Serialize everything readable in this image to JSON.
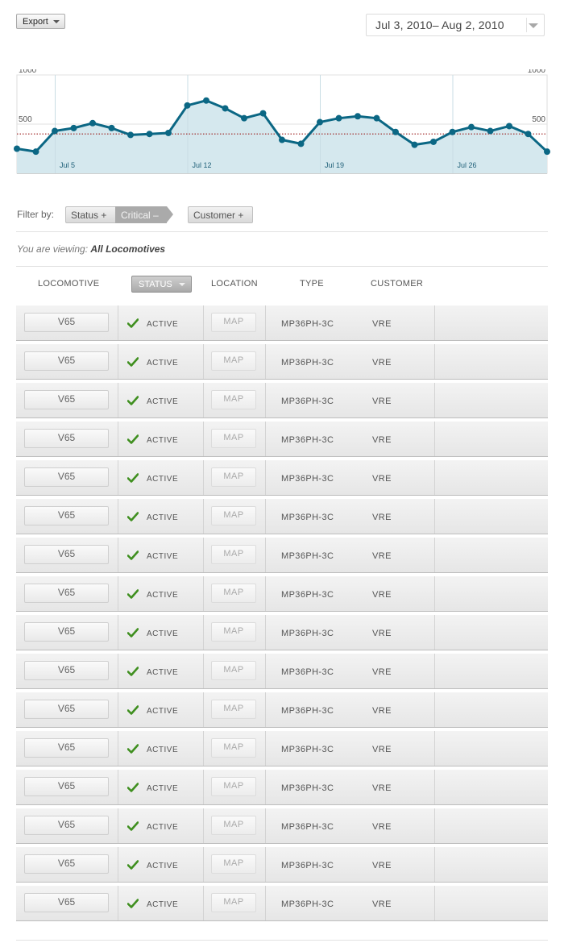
{
  "toolbar": {
    "export_label": "Export",
    "date_range": "Jul 3, 2010– Aug 2, 2010"
  },
  "chart_data": {
    "type": "area",
    "x_days": [
      3,
      4,
      5,
      6,
      7,
      8,
      9,
      10,
      11,
      12,
      13,
      14,
      15,
      16,
      17,
      18,
      19,
      20,
      21,
      22,
      23,
      24,
      25,
      26,
      27,
      28,
      29,
      30
    ],
    "x_tick_labels": [
      "Jul 5",
      "Jul 12",
      "Jul 19",
      "Jul 26"
    ],
    "x_tick_days": [
      5,
      12,
      19,
      26
    ],
    "values": [
      250,
      220,
      430,
      460,
      510,
      460,
      390,
      400,
      410,
      690,
      740,
      660,
      560,
      610,
      340,
      300,
      520,
      560,
      580,
      560,
      420,
      290,
      320,
      420,
      470,
      430,
      480,
      400,
      220
    ],
    "y_ticks": [
      500,
      1000
    ],
    "y_tick_labels_left": [
      "500",
      "1000"
    ],
    "y_tick_labels_right": [
      "500",
      "1000"
    ],
    "ylim": [
      0,
      1000
    ],
    "threshold": 400,
    "line_color": "#0b6784",
    "fill_color": "#d5e8ee",
    "threshold_color": "#9b1c1c",
    "grid": true
  },
  "filters": {
    "label": "Filter by:",
    "status": "Status +",
    "critical": "Critical –",
    "customer": "Customer +"
  },
  "viewing": {
    "prefix": "You are viewing:",
    "value": "All Locomotives"
  },
  "columns": {
    "locomotive": "Locomotive",
    "status": "Status",
    "location": "Location",
    "type": "Type",
    "customer": "Customer"
  },
  "rows": [
    {
      "loco": "V65",
      "status": "ACTIVE",
      "map": "MAP",
      "type": "MP36PH-3C",
      "customer": "VRE"
    },
    {
      "loco": "V65",
      "status": "ACTIVE",
      "map": "MAP",
      "type": "MP36PH-3C",
      "customer": "VRE"
    },
    {
      "loco": "V65",
      "status": "ACTIVE",
      "map": "MAP",
      "type": "MP36PH-3C",
      "customer": "VRE"
    },
    {
      "loco": "V65",
      "status": "ACTIVE",
      "map": "MAP",
      "type": "MP36PH-3C",
      "customer": "VRE"
    },
    {
      "loco": "V65",
      "status": "ACTIVE",
      "map": "MAP",
      "type": "MP36PH-3C",
      "customer": "VRE"
    },
    {
      "loco": "V65",
      "status": "ACTIVE",
      "map": "MAP",
      "type": "MP36PH-3C",
      "customer": "VRE"
    },
    {
      "loco": "V65",
      "status": "ACTIVE",
      "map": "MAP",
      "type": "MP36PH-3C",
      "customer": "VRE"
    },
    {
      "loco": "V65",
      "status": "ACTIVE",
      "map": "MAP",
      "type": "MP36PH-3C",
      "customer": "VRE"
    },
    {
      "loco": "V65",
      "status": "ACTIVE",
      "map": "MAP",
      "type": "MP36PH-3C",
      "customer": "VRE"
    },
    {
      "loco": "V65",
      "status": "ACTIVE",
      "map": "MAP",
      "type": "MP36PH-3C",
      "customer": "VRE"
    },
    {
      "loco": "V65",
      "status": "ACTIVE",
      "map": "MAP",
      "type": "MP36PH-3C",
      "customer": "VRE"
    },
    {
      "loco": "V65",
      "status": "ACTIVE",
      "map": "MAP",
      "type": "MP36PH-3C",
      "customer": "VRE"
    },
    {
      "loco": "V65",
      "status": "ACTIVE",
      "map": "MAP",
      "type": "MP36PH-3C",
      "customer": "VRE"
    },
    {
      "loco": "V65",
      "status": "ACTIVE",
      "map": "MAP",
      "type": "MP36PH-3C",
      "customer": "VRE"
    },
    {
      "loco": "V65",
      "status": "ACTIVE",
      "map": "MAP",
      "type": "MP36PH-3C",
      "customer": "VRE"
    },
    {
      "loco": "V65",
      "status": "ACTIVE",
      "map": "MAP",
      "type": "MP36PH-3C",
      "customer": "VRE"
    }
  ]
}
